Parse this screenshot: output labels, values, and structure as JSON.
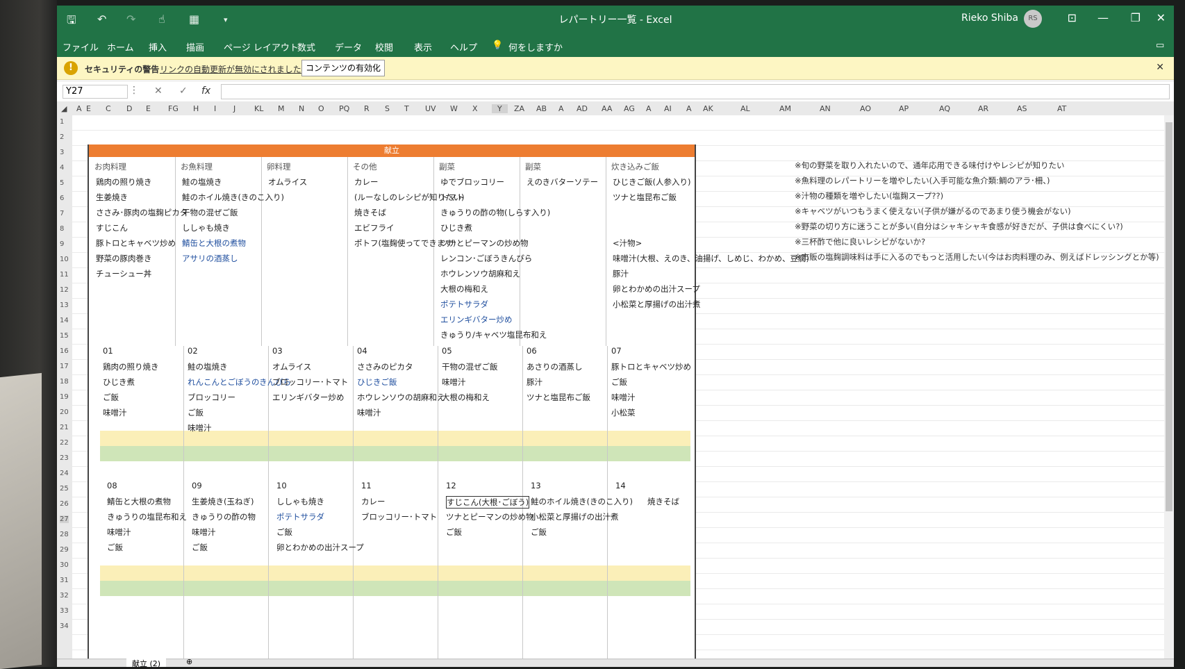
{
  "window": {
    "title": "レパートリー一覧 - Excel",
    "user": "Rieko Shiba",
    "avatar_initials": "RS"
  },
  "ribbon_tabs": [
    "ファイル",
    "ホーム",
    "挿入",
    "描画",
    "ページ レイアウト",
    "数式",
    "データ",
    "校閲",
    "表示",
    "ヘルプ"
  ],
  "tell_me": "何をしますか",
  "security": {
    "title": "セキュリティの警告",
    "message": "リンクの自動更新が無効にされました",
    "button": "コンテンツの有効化"
  },
  "formula_bar": {
    "name_box": "Y27",
    "fx": "fx",
    "value": ""
  },
  "columns": [
    "A",
    "E",
    "C",
    "D",
    "E",
    "FG",
    "H",
    "I",
    "J",
    "KL",
    "M",
    "N",
    "O",
    "PQ",
    "R",
    "S",
    "T",
    "UV",
    "W",
    "X",
    "Y",
    "ZA",
    "AB",
    "A",
    "AD",
    "AA",
    "AG",
    "A",
    "AI",
    "A",
    "AK",
    "AL",
    "AM",
    "AN",
    "AO",
    "AP",
    "AQ",
    "AR",
    "AS",
    "AT"
  ],
  "rows": [
    "1",
    "2",
    "3",
    "4",
    "5",
    "6",
    "7",
    "8",
    "9",
    "10",
    "11",
    "12",
    "13",
    "14",
    "15",
    "16",
    "17",
    "18",
    "19",
    "20",
    "21",
    "22",
    "23",
    "24",
    "25",
    "26",
    "27",
    "28",
    "29",
    "30",
    "31",
    "32",
    "33",
    "34"
  ],
  "banner": "献立",
  "categories": [
    {
      "header": "お肉料理",
      "items": [
        "鶏肉の照り焼き",
        "生姜焼き",
        "ささみ･豚肉の塩麹ピカタ",
        "すじこん",
        "豚トロとキャベツ炒め",
        "野菜の豚肉巻き",
        "チューシュー丼"
      ]
    },
    {
      "header": "お魚料理",
      "items": [
        "鮭の塩焼き",
        "鮭のホイル焼き(きのこ入り)",
        "干物の混ぜご飯",
        "ししゃも焼き",
        "鯖缶と大根の煮物",
        "アサリの酒蒸し"
      ]
    },
    {
      "header": "卵料理",
      "items": [
        "オムライス"
      ]
    },
    {
      "header": "その他",
      "items": [
        "カレー",
        "(ルーなしのレシピが知りたい)",
        "焼きそば",
        "エビフライ",
        "ポトフ(塩麹使ってできます)"
      ]
    },
    {
      "header": "副菜",
      "items": [
        "ゆでブロッコリー",
        "トマト",
        "きゅうりの酢の物(しらす入り)",
        "ひじき煮",
        "ツナとピーマンの炒め物",
        "レンコン･ごぼうきんぴら",
        "ホウレンソウ胡麻和え",
        "大根の梅和え",
        "ポテトサラダ",
        "エリンギバター炒め",
        "きゅうり/キャベツ塩昆布和え"
      ]
    },
    {
      "header": "副菜",
      "items": [
        "えのきバターソテー"
      ]
    },
    {
      "header": "炊き込みご飯",
      "items": [
        "ひじきご飯(人参入り)",
        "ツナと塩昆布ご飯",
        "",
        "<汁物>",
        "味噌汁(大根、えのき、油揚げ、しめじ、わかめ、豆腐)",
        "豚汁",
        "卵とわかめの出汁スープ",
        "小松菜と厚揚げの出汁煮"
      ]
    }
  ],
  "days_week1": [
    {
      "day": "01",
      "items": [
        "鶏肉の照り焼き",
        "ひじき煮",
        "ご飯",
        "味噌汁"
      ]
    },
    {
      "day": "02",
      "items": [
        "鮭の塩焼き",
        "れんこんとごぼうのきんぴら",
        "ブロッコリー",
        "ご飯",
        "味噌汁"
      ]
    },
    {
      "day": "03",
      "items": [
        "オムライス",
        "ブロッコリー･トマト",
        "エリンギバター炒め"
      ]
    },
    {
      "day": "04",
      "items": [
        "ささみのピカタ",
        "ひじきご飯",
        "ホウレンソウの胡麻和え",
        "味噌汁"
      ]
    },
    {
      "day": "05",
      "items": [
        "干物の混ぜご飯",
        "味噌汁",
        "大根の梅和え"
      ]
    },
    {
      "day": "06",
      "items": [
        "あさりの酒蒸し",
        "豚汁",
        "ツナと塩昆布ご飯"
      ]
    },
    {
      "day": "07",
      "items": [
        "豚トロとキャベツ炒め",
        "ご飯",
        "味噌汁",
        "小松菜"
      ]
    }
  ],
  "days_week2": [
    {
      "day": "08",
      "items": [
        "鯖缶と大根の煮物",
        "きゅうりの塩昆布和え",
        "味噌汁",
        "ご飯"
      ]
    },
    {
      "day": "09",
      "items": [
        "生姜焼き(玉ねぎ)",
        "きゅうりの酢の物",
        "味噌汁",
        "ご飯"
      ]
    },
    {
      "day": "10",
      "items": [
        "ししゃも焼き",
        "ポテトサラダ",
        "ご飯",
        "卵とわかめの出汁スープ"
      ]
    },
    {
      "day": "11",
      "items": [
        "カレー",
        "ブロッコリー･トマト"
      ]
    },
    {
      "day": "12",
      "items": [
        "すじこん(大根･ごぼう)",
        "ツナとピーマンの炒め物",
        "ご飯"
      ]
    },
    {
      "day": "13",
      "items": [
        "鮭のホイル焼き(きのこ入り)",
        "小松菜と厚揚げの出汁煮",
        "ご飯"
      ]
    },
    {
      "day": "14",
      "items": [
        "焼きそば"
      ]
    }
  ],
  "notes": [
    "※旬の野菜を取り入れたいので、通年応用できる味付けやレシピが知りたい",
    "※魚料理のレパートリーを増やしたい(入手可能な魚介類:鯛のアラ･柵、)",
    "※汁物の種類を増やしたい(塩麹スープ??)",
    "※キャベツがいつもうまく使えない(子供が嫌がるのであまり使う機会がない)",
    "※野菜の切り方に迷うことが多い(自分はシャキシャキ食感が好きだが、子供は食べにくい?)",
    "※三杯酢で他に良いレシピがないか?",
    "※市販の塩麹調味料は手に入るのでもっと活用したい(今はお肉料理のみ、例えばドレッシングとか等)"
  ],
  "sheet_tab": "献立 (2)"
}
